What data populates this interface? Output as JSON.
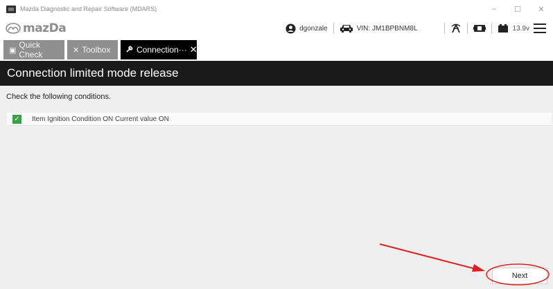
{
  "window": {
    "title": "Mazda Diagnostic and Repair Software (MDARS)",
    "controls": {
      "minimize": "–",
      "maximize": "☐",
      "close": "✕"
    }
  },
  "header": {
    "logo_text": "mazDa",
    "user": "dgonzale",
    "vin": "VIN: JM1BPBNM8L",
    "voltage": "13.9v",
    "icons": [
      "user-icon",
      "car-icon",
      "signal-icon",
      "vci-icon",
      "battery-icon",
      "menu-icon"
    ]
  },
  "tabs": [
    {
      "label": "Quick Check",
      "icon": "clipboard-icon"
    },
    {
      "label": "Toolbox",
      "icon": "tools-icon"
    },
    {
      "label": "Connection···",
      "icon": "wrench-icon",
      "close": "✕"
    }
  ],
  "page": {
    "title": "Connection limited mode release",
    "instruction": "Check the following conditions.",
    "conditions": [
      {
        "checked": true,
        "text": "Item Ignition Condition ON Current value ON"
      }
    ],
    "next_label": "Next"
  },
  "colors": {
    "title_bar_bg": "#1a1a1a",
    "check_green": "#3aa04a",
    "annotation_red": "#e02020"
  }
}
